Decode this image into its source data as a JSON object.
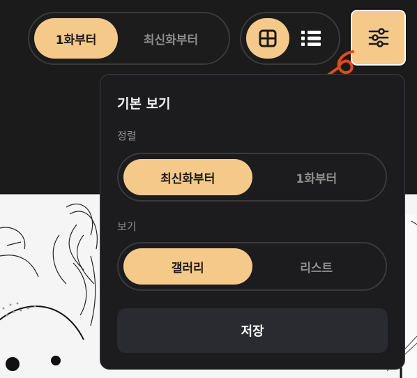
{
  "toolbar": {
    "order_options": [
      "1화부터",
      "최신화부터"
    ],
    "order_selected": "1화부터",
    "view_options": [
      {
        "icon": "grid-icon",
        "selected": true
      },
      {
        "icon": "list-icon",
        "selected": false
      }
    ],
    "settings_icon": "sliders-icon"
  },
  "panel": {
    "title": "기본 보기",
    "sort": {
      "label": "정렬",
      "options": [
        "최신화부터",
        "1화부터"
      ],
      "selected": "최신화부터"
    },
    "view": {
      "label": "보기",
      "options": [
        "갤러리",
        "리스트"
      ],
      "selected": "갤러리"
    },
    "save_label": "저장"
  },
  "annotation": {
    "number": "6"
  },
  "colors": {
    "background": "#1b1b1b",
    "accent": "#f4c98a",
    "panel": "#1c1c1e",
    "save_button": "#2a2b31",
    "annotation": "#e44a1c"
  }
}
